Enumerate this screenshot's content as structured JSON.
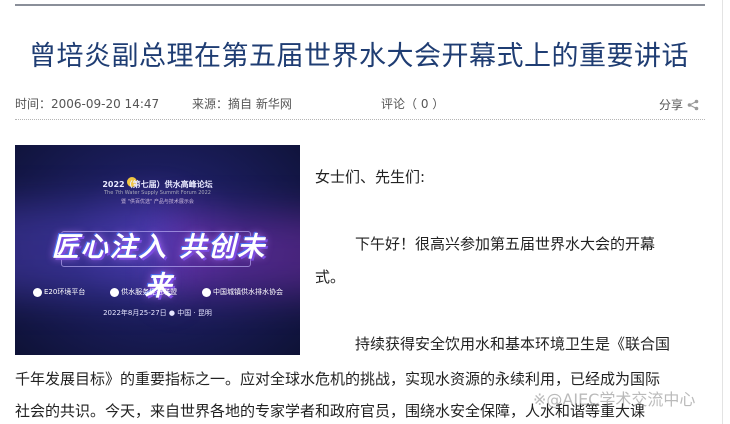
{
  "article": {
    "title": "曾培炎副总理在第五届世界水大会开幕式上的重要讲话",
    "time": "时间：2006-09-20 14:47",
    "source": "来源：摘自 新华网",
    "comments": "评论（ 0 ）",
    "share_label": "分享",
    "paragraphs": {
      "p1": "女士们、先生们:",
      "p2_line1": "下午好！很高兴参加第五届世界水大会的开幕",
      "p2_line2": "式。",
      "p3_line1": "持续获得安全饮用水和基本环境卫生是《联合国",
      "p3_line2": "千年发展目标》的重要指标之一。应对全球水危机的挑战，实现水资源的永续利用，已经成为国际",
      "p3_line3": "社会的共识。今天，来自世界各地的专家学者和政府官员，围绕水安全保障，人水和谐等重大课"
    }
  },
  "banner": {
    "line1": "2022（第七届）供水高峰论坛",
    "line2": "The 7th Water Supply Summit Forum 2022",
    "line3": "暨 \"供百优选\" 产品与技术展示会",
    "slogan": "匠心注入  共创未来",
    "partner1": "E20环境平台",
    "partner2": "供水服务促进联盟",
    "partner3": "中国城镇供水排水协会",
    "date": "2022年8月25-27日 ● 中国 · 昆明"
  },
  "watermark": "※@AIEC学术交流中心",
  "colors": {
    "title": "#1f3d73",
    "rule": "#8a8f99"
  },
  "icons": {
    "share": "share-icon"
  }
}
